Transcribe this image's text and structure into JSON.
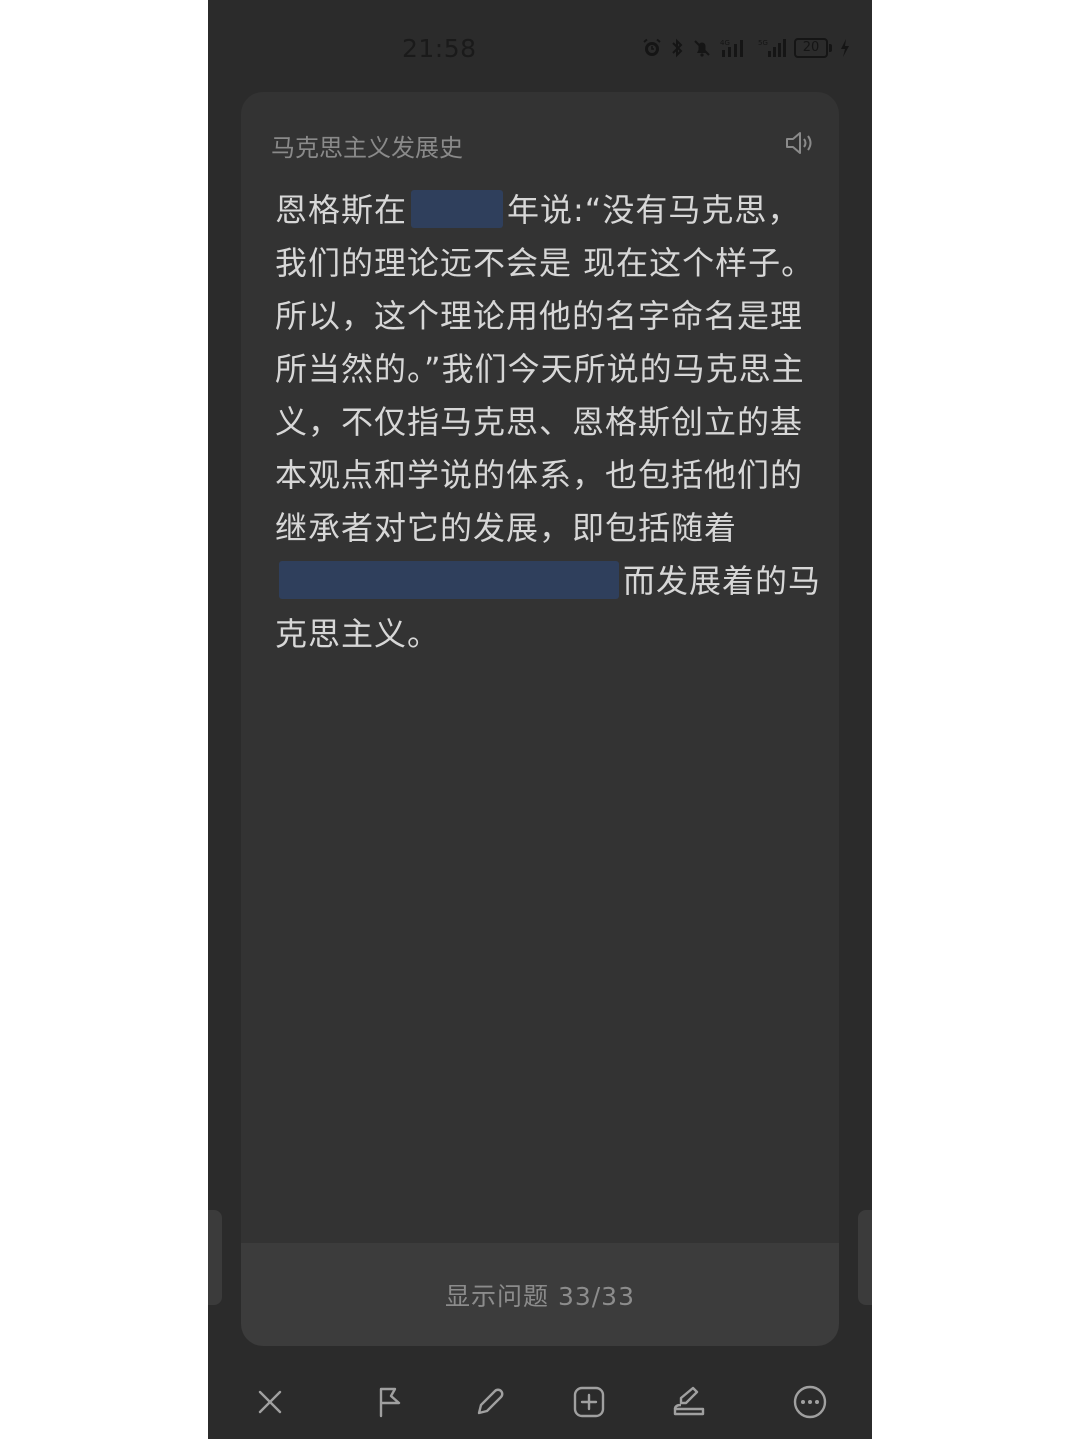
{
  "status_bar": {
    "time": "21:58",
    "battery_level": "20",
    "icons": [
      "alarm-icon",
      "bluetooth-icon",
      "mute-icon",
      "signal-4g-icon",
      "signal-5g-icon",
      "battery-icon",
      "charging-icon"
    ]
  },
  "card": {
    "title": "马克思主义发展史",
    "passage": {
      "part1": "恩格斯在",
      "part2": "年说:“没有马克思，我们的理论远不会是 现在这个样子。所以，这个理论用他的名字命名是理所当然的。”我们今天所说的马克思主义，不仅指马克思、恩格斯创立的基本观点和学说的体系，也包括他们的继承者对它的发展，即包括随着",
      "part3": "而发展着的马克思主义。"
    },
    "blank_color": "#2f3f5c"
  },
  "show_question": {
    "label": "显示问题 33/33"
  },
  "toolbar": {
    "items": [
      "close-icon",
      "flag-icon",
      "edit-icon",
      "add-card-icon",
      "stamp-icon",
      "more-icon"
    ]
  },
  "colors": {
    "background": "#2b2b2b",
    "card": "#333333",
    "text": "#d7d7d7",
    "muted": "#8a8a8a"
  }
}
